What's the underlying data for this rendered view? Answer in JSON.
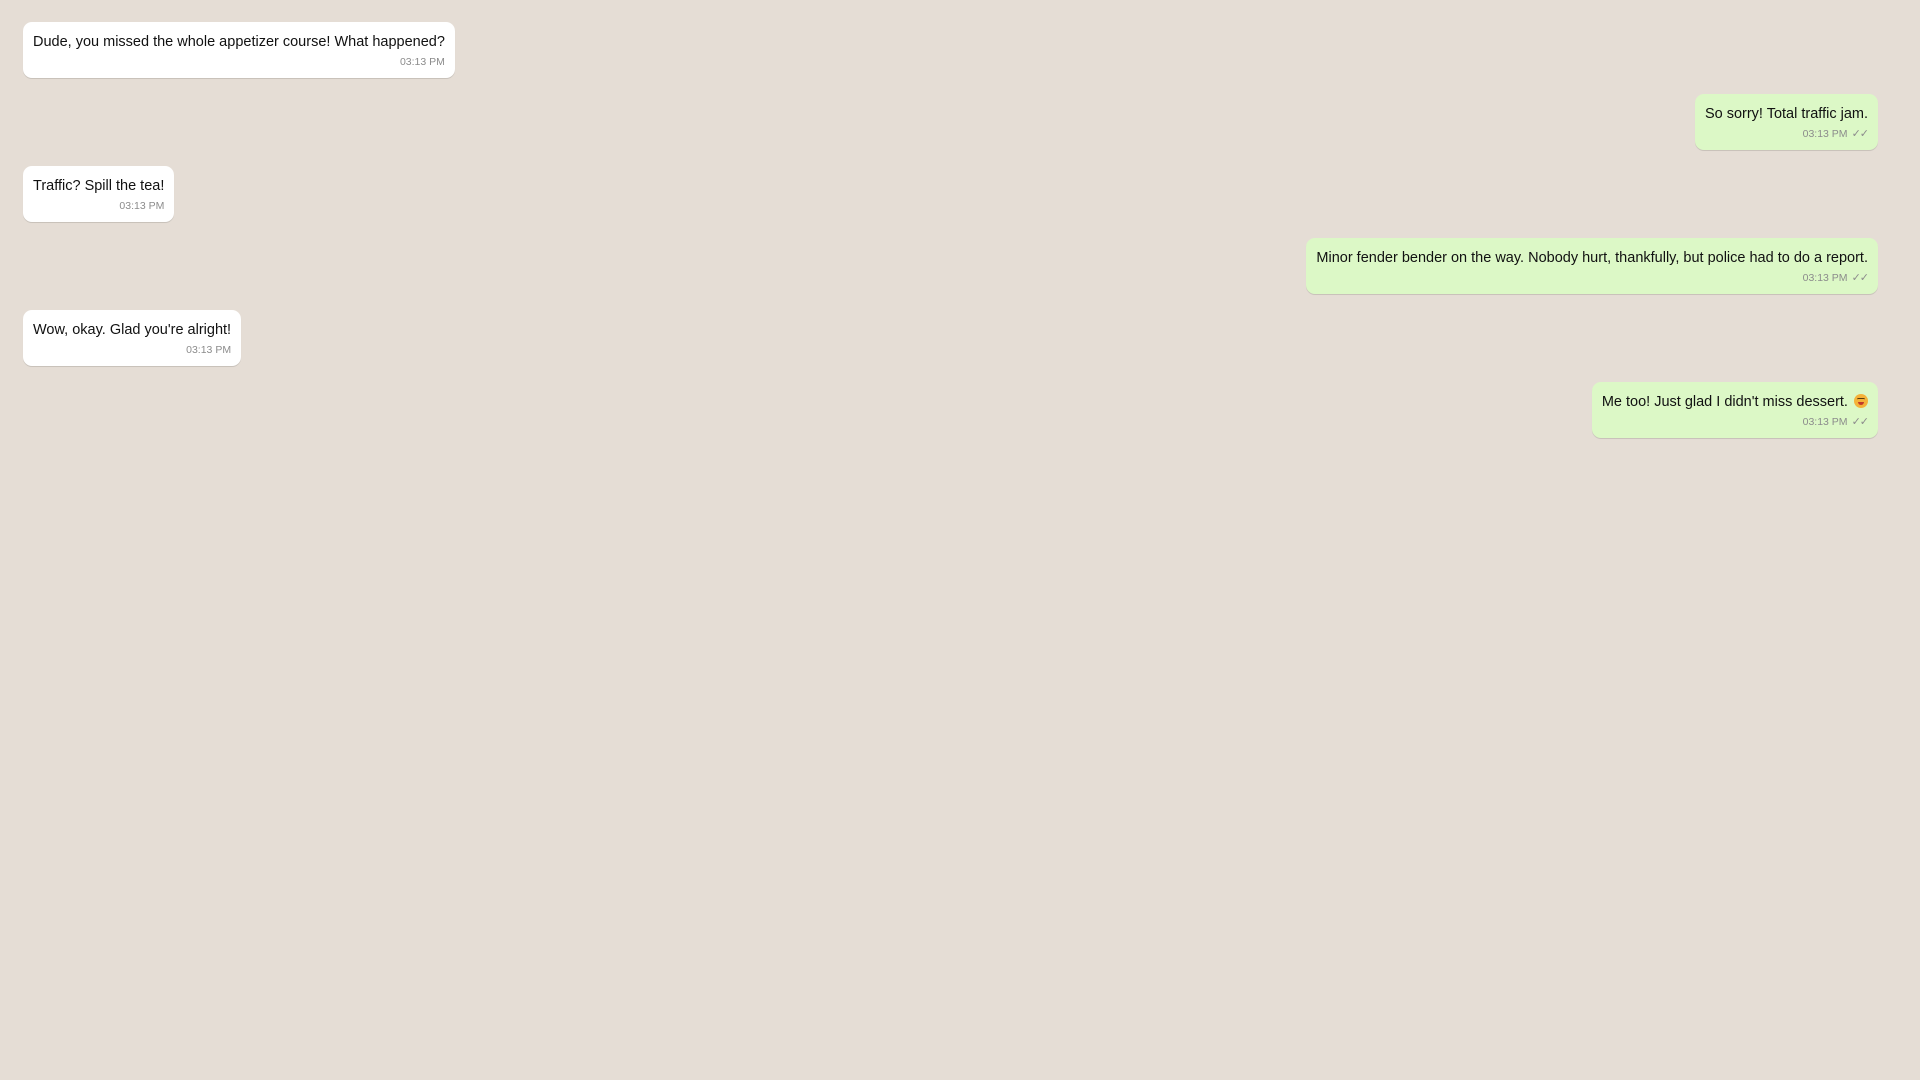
{
  "messages": [
    {
      "direction": "in",
      "text": "Dude, you missed the whole appetizer course! What happened?",
      "time": "03:13 PM",
      "ticks": ""
    },
    {
      "direction": "out",
      "text": "So sorry! Total traffic jam.",
      "time": "03:13 PM",
      "ticks": "✓✓"
    },
    {
      "direction": "in",
      "text": "Traffic? Spill the tea!",
      "time": "03:13 PM",
      "ticks": ""
    },
    {
      "direction": "out",
      "text": "Minor fender bender on the way. Nobody hurt, thankfully, but police had to do a report.",
      "time": "03:13 PM",
      "ticks": "✓✓"
    },
    {
      "direction": "in",
      "text": "Wow, okay. Glad you're alright!",
      "time": "03:13 PM",
      "ticks": ""
    },
    {
      "direction": "out",
      "text": "Me too! Just glad I didn't miss dessert.",
      "time": "03:13 PM",
      "ticks": "✓✓",
      "emoji": "grinning-face-emoji"
    }
  ],
  "colors": {
    "background": "#e5ddd5",
    "incoming_bubble": "#ffffff",
    "outgoing_bubble": "#dcf8c6",
    "meta_text": "#8c8c8c"
  }
}
